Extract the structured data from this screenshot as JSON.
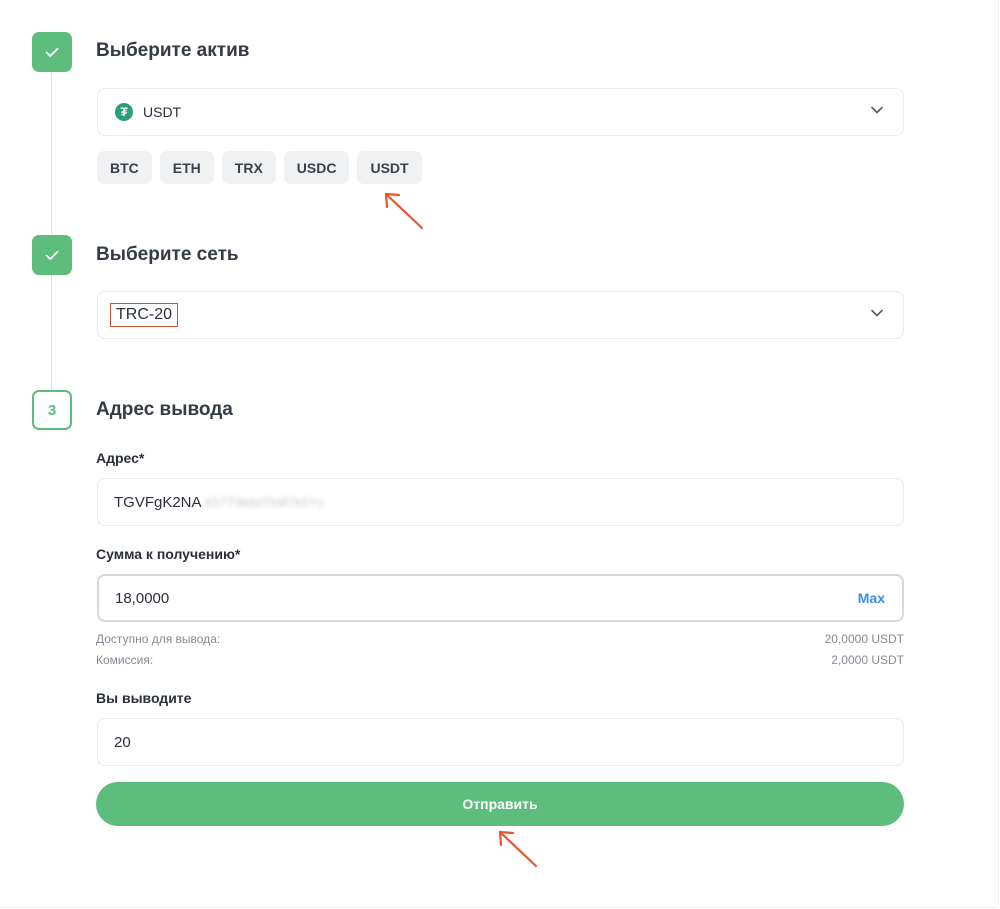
{
  "steps": {
    "asset": {
      "title": "Выберите актив",
      "selected": "USDT",
      "coin_symbol": "₮",
      "quick_assets": [
        "BTC",
        "ETH",
        "TRX",
        "USDC",
        "USDT"
      ]
    },
    "network": {
      "title": "Выберите сеть",
      "selected": "TRC-20"
    },
    "withdraw": {
      "number": "3",
      "title": "Адрес вывода",
      "address_label": "Адрес*",
      "address_value": "TGVFgK2NA",
      "address_hidden": "X57T9k6dTk9f7k5Yz",
      "amount_label": "Сумма к получению*",
      "amount_value": "18,0000",
      "max_label": "Max",
      "available_label": "Доступно для вывода:",
      "available_value": "20,0000 USDT",
      "fee_label": "Комиссия:",
      "fee_value": "2,0000 USDT",
      "total_label": "Вы выводите",
      "total_value": "20",
      "submit_label": "Отправить"
    }
  },
  "colors": {
    "accent": "#5cbd7d",
    "link": "#3d8fe0",
    "annotation": "#e8552e",
    "coin": "#2a9d7c"
  },
  "icons": [
    "check-icon",
    "chevron-down-icon",
    "tether-icon",
    "annotation-arrow-icon"
  ]
}
